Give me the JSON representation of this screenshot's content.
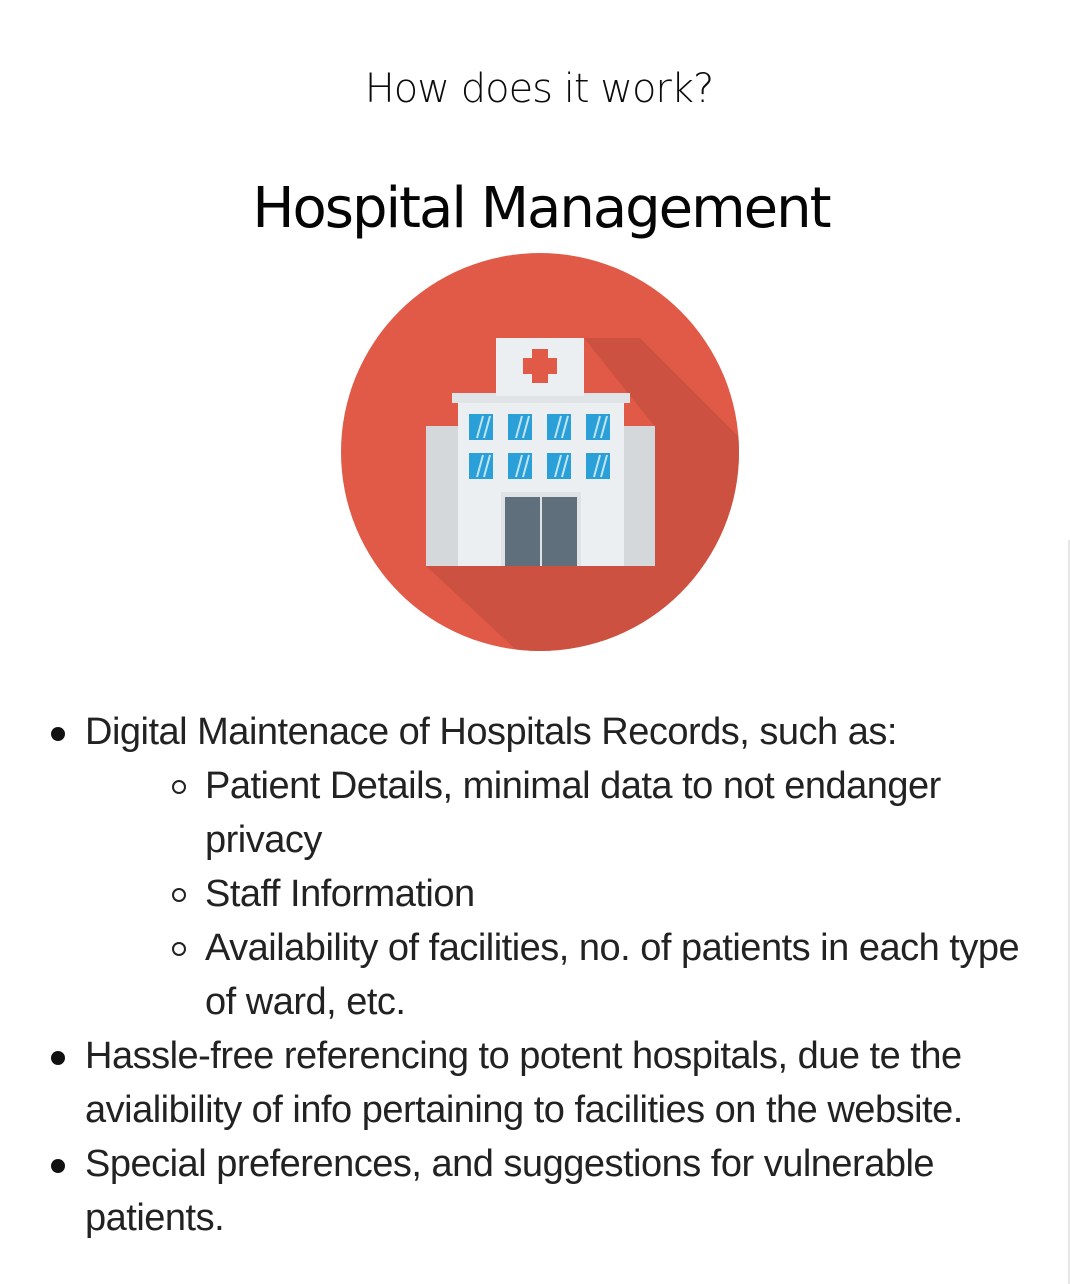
{
  "header": {
    "subtitle": "How does it work?",
    "title": "Hospital Management"
  },
  "illustration": {
    "icon": "hospital-building-icon",
    "colors": {
      "circle": "#e05a47",
      "shadow": "#c44e3e",
      "building": "#eceff1",
      "building_side": "#d4d8db",
      "windows": "#2a9fd8",
      "door": "#5f6f7c",
      "cross": "#e05a47"
    }
  },
  "list": {
    "item1": {
      "text": "Digital Maintenace of Hospitals Records, such as:",
      "sub": [
        "Patient Details, minimal data to not endanger privacy",
        "Staff Information",
        "Availability of facilities, no. of patients in each type of ward, etc."
      ]
    },
    "item2": {
      "text": "Hassle-free referencing to potent hospitals, due te the avialibility of info pertaining to facilities on the website."
    },
    "item3": {
      "text": "Special preferences, and suggestions for vulnerable patients."
    }
  }
}
